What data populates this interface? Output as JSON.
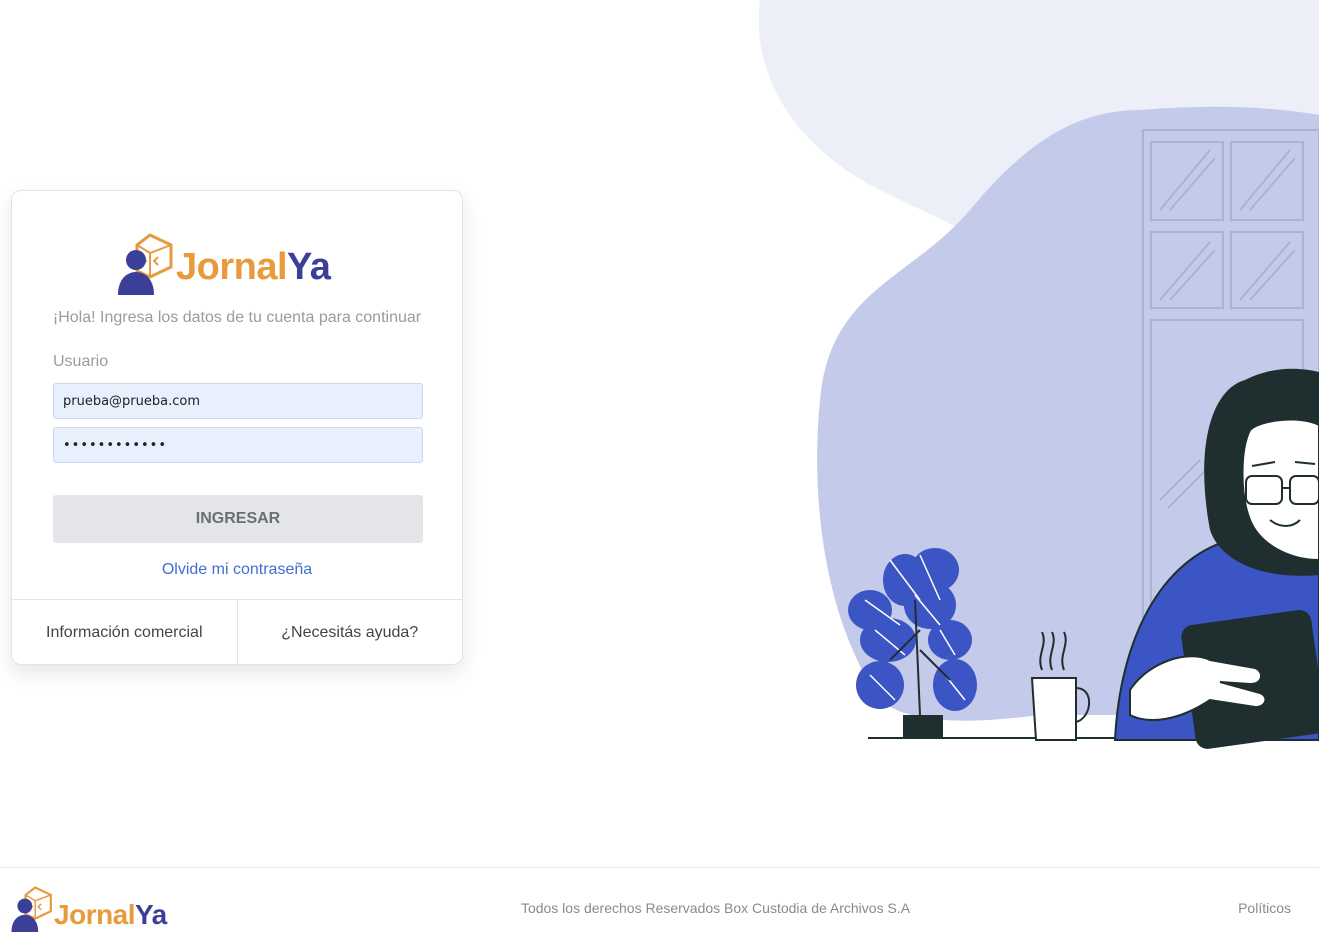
{
  "brand": {
    "name_part1": "Jornal",
    "name_part2": "Ya",
    "color_primary": "#e79b3c",
    "color_secondary": "#3b3f97"
  },
  "login": {
    "greeting": "¡Hola! Ingresa los datos de tu cuenta para continuar",
    "user_label": "Usuario",
    "user_value": "prueba@prueba.com",
    "password_value": "••••••••••••",
    "submit_label": "INGRESAR",
    "forgot_label": "Olvide mi contraseña",
    "links": {
      "commercial": "Información comercial",
      "help": "¿Necesitás ayuda?"
    }
  },
  "footer": {
    "copyright": "Todos los derechos Reservados Box Custodia de Archivos S.A",
    "policies": "Políticos"
  },
  "colors": {
    "link": "#3f6fd3",
    "input_bg": "#e8f0fe",
    "button_bg": "#e4e5e8",
    "illustration_blue": "#3c55c4"
  }
}
